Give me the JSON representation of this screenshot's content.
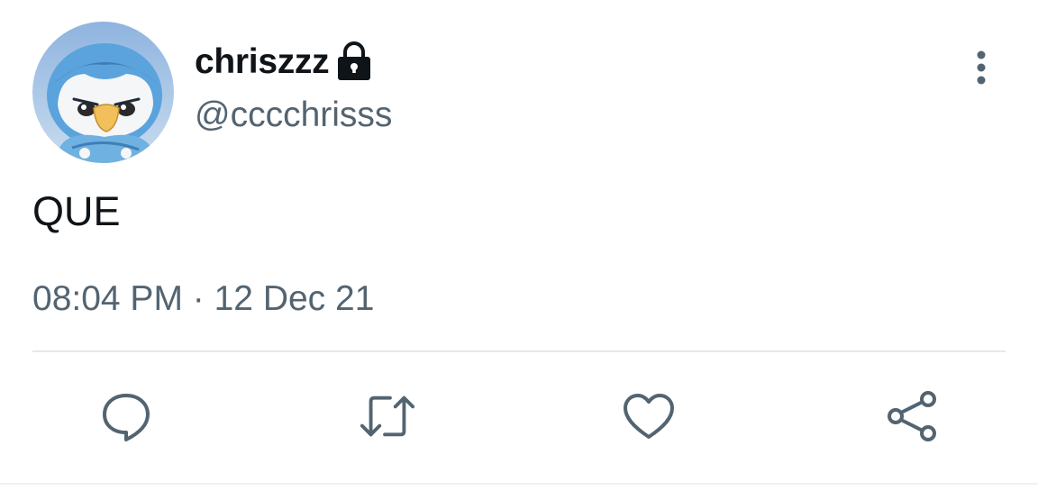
{
  "tweet": {
    "author": {
      "display_name": "chriszzz",
      "handle": "@cccchrisss",
      "protected_icon": "lock-icon",
      "avatar": "piplup-avatar"
    },
    "text": "QUE",
    "time": "08:04 PM",
    "separator": " · ",
    "date": "12 Dec 21"
  },
  "actions": [
    {
      "name": "reply",
      "icon": "reply-icon"
    },
    {
      "name": "retweet",
      "icon": "retweet-icon"
    },
    {
      "name": "like",
      "icon": "heart-icon"
    },
    {
      "name": "share",
      "icon": "share-icon"
    }
  ],
  "menu_icon": "more-vertical-icon",
  "colors": {
    "text_primary": "#0f1419",
    "text_secondary": "#536471",
    "icon": "#536471",
    "divider": "#e6e8ea"
  }
}
